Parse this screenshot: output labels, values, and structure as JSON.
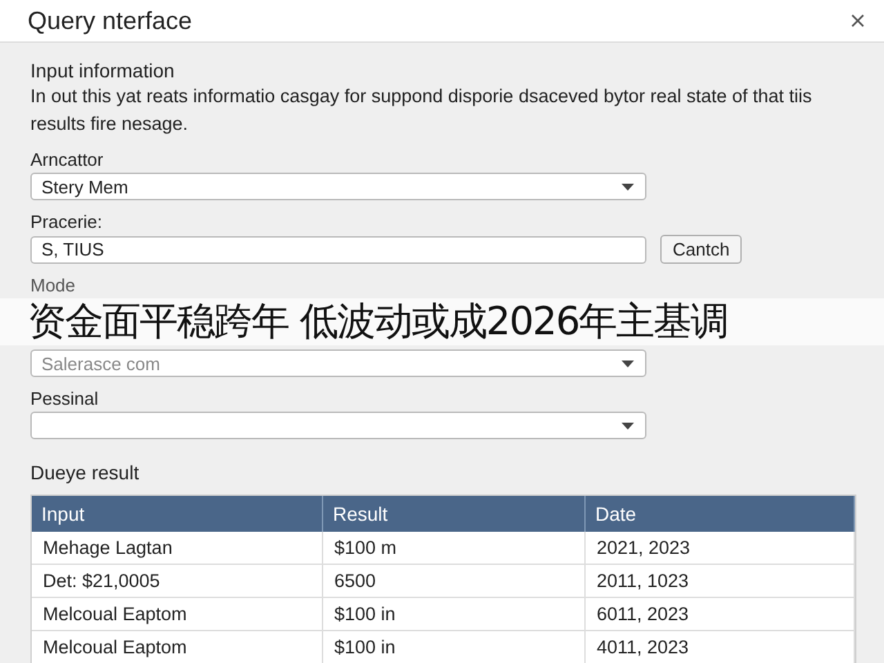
{
  "window": {
    "title": "Query nterface"
  },
  "input_section": {
    "heading": "Input information",
    "description": "In out this yat reats informatio casgay for suppond disporie dsaceved bytor real state of that tiis results fire nesage."
  },
  "fields": [
    {
      "kind": "select",
      "label": "Arncattor",
      "value": "Stery Mem"
    },
    {
      "kind": "text",
      "label": "Pracerie:",
      "value": "S, TIUS",
      "button": "Cantch"
    },
    {
      "kind": "select",
      "label": "Mode",
      "placeholder": "Salerasce com"
    },
    {
      "kind": "select",
      "label": "Pessinal"
    }
  ],
  "banner": {
    "text": "资金面平稳跨年 低波动或成2026年主基调"
  },
  "results": {
    "heading": "Dueye result",
    "columns": [
      "Input",
      "Result",
      "Date"
    ],
    "rows": [
      [
        "Mehage Lagtan",
        "$100 m",
        "2021, 2023"
      ],
      [
        "Det: $21,0005",
        "6500",
        "2011, 1023"
      ],
      [
        "Melcoual Eaptom",
        "$100 in",
        "6011, 2023"
      ],
      [
        "Melcoual Eaptom",
        "$100 in",
        "4011, 2023"
      ]
    ]
  }
}
